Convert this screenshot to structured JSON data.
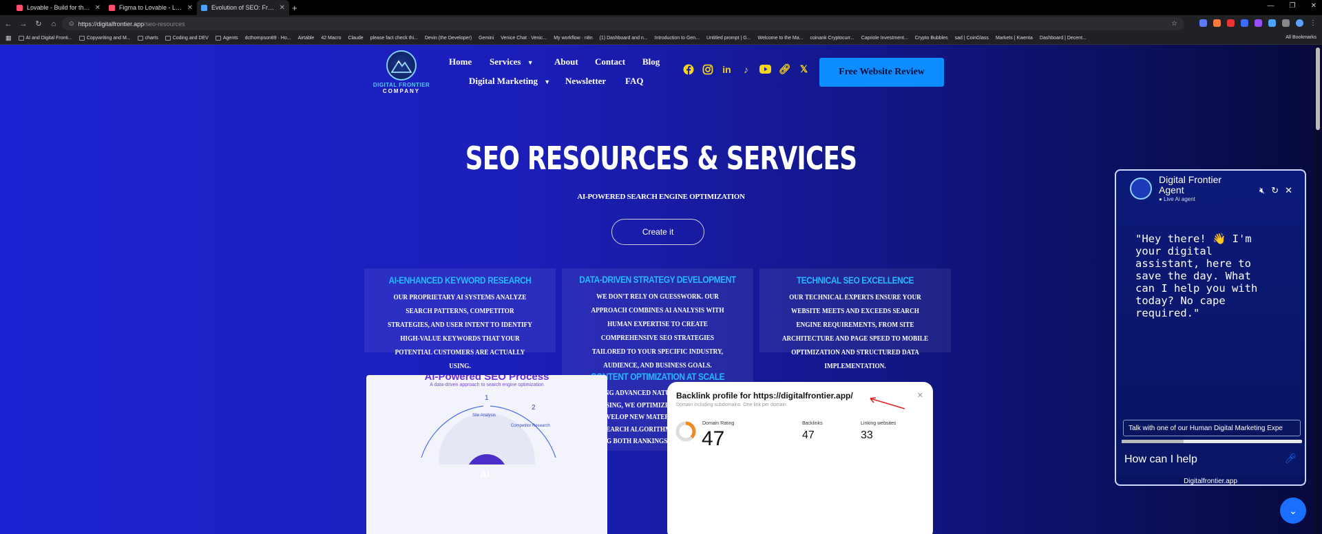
{
  "browser": {
    "tabs": [
      {
        "label": "Lovable - Build for the web 20...",
        "color": "#ff4d6d"
      },
      {
        "label": "Figma to Lovable - Lovable Do...",
        "color": "#ff4d6d"
      },
      {
        "label": "Evolution of SEO: From Keywo...",
        "color": "#4da3ff"
      }
    ],
    "url_host": "https://digitalfrontier.app",
    "url_path": "/seo-resources",
    "bookmarks": [
      "AI and Digital Fronti...",
      "Copywriting and M...",
      "charts",
      "Coding and DEV",
      "Agents",
      "dcthompson89 · Ho...",
      "Airtable",
      "42 Macro",
      "Claude",
      "please fact check thi...",
      "Devin (the Developer)",
      "Gemini",
      "Venice Chat · Venic...",
      "My workflow · n8n",
      "(1) Dashboard and n...",
      "Introduction to Gen...",
      "Untitled prompt | G...",
      "Welcome to the Ma...",
      "coinank Cryptocurr...",
      "Capriole Investment...",
      "Crypto Bubbles",
      "sad | CoinGlass",
      "Markets | Kwenta",
      "Dashboard | Decent..."
    ],
    "all_bookmarks": "All Bookmarks"
  },
  "site": {
    "logo_line1": "DIGITAL FRONTIER",
    "logo_line2": "COMPANY",
    "nav": {
      "home": "Home",
      "services": "Services",
      "about": "About",
      "contact": "Contact",
      "blog": "Blog",
      "digital_marketing": "Digital Marketing",
      "newsletter": "Newsletter",
      "faq": "FAQ"
    },
    "cta": "Free Website Review",
    "hero_title": "SEO RESOURCES & SERVICES",
    "hero_sub": "AI-POWERED SEARCH ENGINE OPTIMIZATION",
    "create_button": "Create it",
    "cards": [
      {
        "title": "AI-ENHANCED KEYWORD RESEARCH",
        "body": "OUR PROPRIETARY AI SYSTEMS ANALYZE SEARCH PATTERNS, COMPETITOR STRATEGIES, AND USER INTENT TO IDENTIFY HIGH-VALUE KEYWORDS THAT YOUR POTENTIAL CUSTOMERS ARE ACTUALLY USING."
      },
      {
        "title": "DATA-DRIVEN STRATEGY DEVELOPMENT",
        "body": "WE DON'T RELY ON GUESSWORK. OUR APPROACH COMBINES AI ANALYSIS WITH HUMAN EXPERTISE TO CREATE COMPREHENSIVE SEO STRATEGIES TAILORED TO YOUR SPECIFIC INDUSTRY, AUDIENCE, AND BUSINESS GOALS."
      },
      {
        "title": "TECHNICAL SEO EXCELLENCE",
        "body": "OUR TECHNICAL EXPERTS ENSURE YOUR WEBSITE MEETS AND EXCEEDS SEARCH ENGINE REQUIREMENTS, FROM SITE ARCHITECTURE AND PAGE SPEED TO MOBILE OPTIMIZATION AND STRUCTURED DATA IMPLEMENTATION."
      },
      {
        "title": "CONTENT OPTIMIZATION AT SCALE",
        "body": "USING ADVANCED NATURAL LANGUAGE PROCESSING, WE OPTIMIZE EXISTING CONTENT AND DEVELOP NEW MATERIAL THAT SATISFIES BOTH SEARCH ALGORITHMS AND USER NEEDS, DRIVING BOTH RANKINGS AND ENGAGEMENT."
      }
    ],
    "process_panel": {
      "title": "AI-Powered SEO Process",
      "subtitle": "A data-driven approach to search engine optimization",
      "step1": "1",
      "step1_label": "Site Analysis",
      "step2": "2",
      "step2_label": "Competitor Research",
      "center": "AI"
    },
    "backlink_panel": {
      "title": "Backlink profile for https://digitalfrontier.app/",
      "subtitle": "Domain including subdomains. One link per domain",
      "domain_rating_label": "Domain Rating",
      "domain_rating": "47",
      "backlinks_label": "Backlinks",
      "backlinks": "47",
      "linking_label": "Linking websites",
      "linking": "33"
    }
  },
  "chat": {
    "title": "Digital Frontier Agent",
    "status": "Live Ai agent",
    "message": "\"Hey there! 👋 I'm your digital assistant, here to save the day. What can I help you with today? No cape required.\"",
    "talk_button": "Talk with one of our Human Digital Marketing Expe",
    "input_placeholder": "How can I help",
    "footer": "Digitalfrontier.app"
  },
  "colors": {
    "accent": "#0d8dff",
    "card_title": "#2ab6ff",
    "social": "#f5d617"
  }
}
